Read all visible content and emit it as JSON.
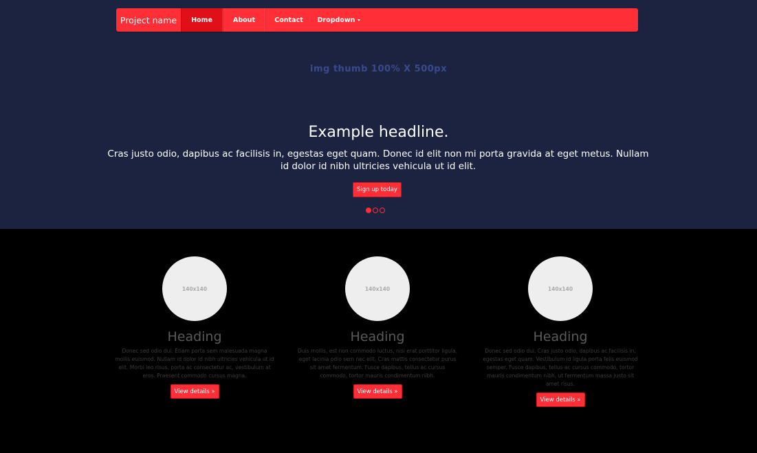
{
  "navbar": {
    "brand": "Project name",
    "items": [
      {
        "label": "Home",
        "active": true
      },
      {
        "label": "About",
        "active": false
      },
      {
        "label": "Contact",
        "active": false
      },
      {
        "label": "Dropdown",
        "active": false
      }
    ]
  },
  "hero": {
    "image_placeholder": "img thumb 100% X 500px",
    "headline": "Example headline.",
    "lead": "Cras justo odio, dapibus ac facilisis in, egestas eget quam. Donec id elit non mi porta gravida at eget metus. Nullam id dolor id nibh ultricies vehicula ut id elit.",
    "button_label": "Sign up today",
    "carousel": {
      "slides": 3,
      "active_index": 0
    }
  },
  "columns": [
    {
      "image_label": "140x140",
      "heading": "Heading",
      "text": "Donec sed odio dui. Etiam porta sem malesuada magna mollis euismod. Nullam id dolor id nibh ultricies vehicula ut id elit. Morbi leo risus, porta ac consectetur ac, vestibulum at eros. Praesent commodo cursus magna.",
      "button_label": "View details »"
    },
    {
      "image_label": "140x140",
      "heading": "Heading",
      "text": "Duis mollis, est non commodo luctus, nisi erat porttitor ligula, eget lacinia odio sem nec elit. Cras mattis consectetur purus sit amet fermentum. Fusce dapibus, tellus ac cursus commodo, tortor mauris condimentum nibh.",
      "button_label": "View details »"
    },
    {
      "image_label": "140x140",
      "heading": "Heading",
      "text": "Donec sed odio dui. Cras justo odio, dapibus ac facilisis in, egestas eget quam. Vestibulum id ligula porta felis euismod semper. Fusce dapibus, tellus ac cursus commodo, tortor mauris condimentum nibh, ut fermentum massa justo sit amet risus.",
      "button_label": "View details »"
    }
  ],
  "colors": {
    "accent": "#ff2e37",
    "accent_active": "#e01018",
    "hero_background": "#1c2340",
    "page_background": "#000000",
    "placeholder_circle": "#eeeeee"
  }
}
